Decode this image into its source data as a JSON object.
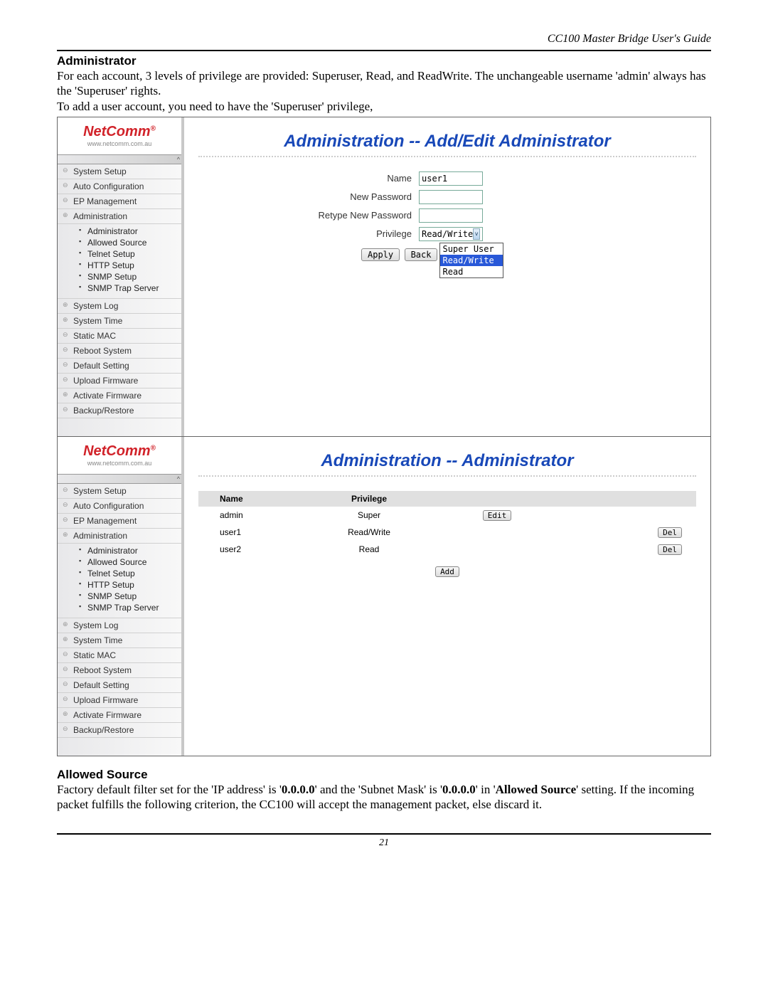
{
  "header": {
    "guide": "CC100 Master Bridge User's Guide"
  },
  "section1": {
    "title": "Administrator",
    "p1": "For each account, 3 levels of privilege are provided: Superuser, Read, and ReadWrite. The unchangeable username 'admin' always has the 'Superuser' rights.",
    "p2": "To add a user account, you need to have the 'Superuser' privilege,"
  },
  "logo": {
    "main": "NetComm",
    "sub": "www.netcomm.com.au",
    "reg": "®"
  },
  "nav": {
    "system_setup": "System Setup",
    "auto_config": "Auto Configuration",
    "ep_mgmt": "EP Management",
    "administration": "Administration",
    "sub": {
      "administrator": "Administrator",
      "allowed_source": "Allowed Source",
      "telnet": "Telnet Setup",
      "http": "HTTP Setup",
      "snmp": "SNMP Setup",
      "snmp_trap": "SNMP Trap Server"
    },
    "syslog": "System Log",
    "systime": "System Time",
    "staticmac": "Static MAC",
    "reboot": "Reboot System",
    "default": "Default Setting",
    "upload": "Upload Firmware",
    "activate": "Activate Firmware",
    "backup": "Backup/Restore"
  },
  "screen1": {
    "title": "Administration -- Add/Edit Administrator",
    "labels": {
      "name": "Name",
      "newpw": "New Password",
      "retypepw": "Retype New Password",
      "priv": "Privilege"
    },
    "values": {
      "name": "user1",
      "priv": "Read/Write"
    },
    "options": {
      "super": "Super User",
      "rw": "Read/Write",
      "read": "Read"
    },
    "buttons": {
      "apply": "Apply",
      "back": "Back"
    }
  },
  "screen2": {
    "title": "Administration -- Administrator",
    "headers": {
      "name": "Name",
      "priv": "Privilege"
    },
    "rows": [
      {
        "name": "admin",
        "priv": "Super",
        "btn": "Edit"
      },
      {
        "name": "user1",
        "priv": "Read/Write",
        "btn": "Del"
      },
      {
        "name": "user2",
        "priv": "Read",
        "btn": "Del"
      }
    ],
    "add": "Add"
  },
  "section2": {
    "title": "Allowed Source",
    "t1": "Factory default filter set for the 'IP address' is '",
    "ip": "0.0.0.0",
    "t2": "' and the 'Subnet Mask' is '",
    "t3": "' in '",
    "as": "Allowed Source",
    "t4": "' setting. If the incoming packet fulfills the following criterion, the CC100 will accept the management packet, else discard it."
  },
  "page_number": "21"
}
